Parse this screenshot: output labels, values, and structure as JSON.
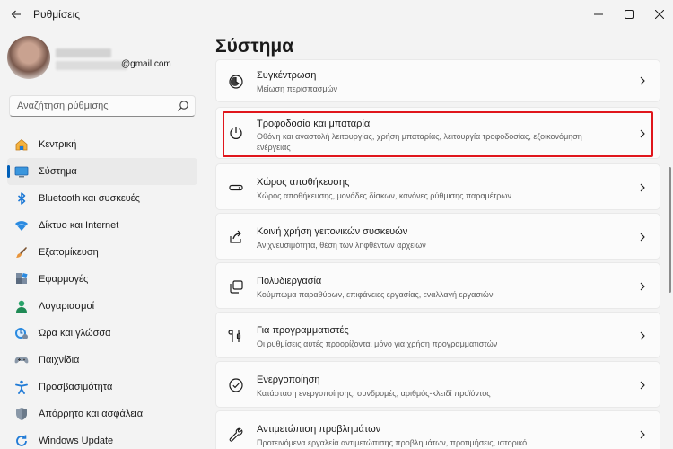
{
  "window": {
    "title": "Ρυθμίσεις"
  },
  "profile": {
    "email_domain": "@gmail.com"
  },
  "search": {
    "placeholder": "Αναζήτηση ρύθμισης"
  },
  "sidebar": {
    "items": [
      {
        "label": "Κεντρική",
        "icon": "home-icon"
      },
      {
        "label": "Σύστημα",
        "icon": "system-icon",
        "active": true
      },
      {
        "label": "Bluetooth και συσκευές",
        "icon": "bluetooth-icon"
      },
      {
        "label": "Δίκτυο και Internet",
        "icon": "wifi-icon"
      },
      {
        "label": "Εξατομίκευση",
        "icon": "brush-icon"
      },
      {
        "label": "Εφαρμογές",
        "icon": "apps-icon"
      },
      {
        "label": "Λογαριασμοί",
        "icon": "account-icon"
      },
      {
        "label": "Ώρα και γλώσσα",
        "icon": "time-language-icon"
      },
      {
        "label": "Παιχνίδια",
        "icon": "gamepad-icon"
      },
      {
        "label": "Προσβασιμότητα",
        "icon": "accessibility-icon"
      },
      {
        "label": "Απόρρητο και ασφάλεια",
        "icon": "shield-icon"
      },
      {
        "label": "Windows Update",
        "icon": "update-icon"
      }
    ]
  },
  "main": {
    "title": "Σύστημα",
    "cards": [
      {
        "title": "Συγκέντρωση",
        "desc": "Μείωση περισπασμών",
        "icon": "focus-icon"
      },
      {
        "title": "Τροφοδοσία και μπαταρία",
        "desc": "Οθόνη και αναστολή λειτουργίας, χρήση μπαταρίας, λειτουργία τροφοδοσίας, εξοικονόμηση ενέργειας",
        "icon": "power-icon"
      },
      {
        "title": "Χώρος αποθήκευσης",
        "desc": "Χώρος αποθήκευσης, μονάδες δίσκων, κανόνες ρύθμισης παραμέτρων",
        "icon": "storage-icon"
      },
      {
        "title": "Κοινή χρήση γειτονικών συσκευών",
        "desc": "Ανιχνευσιμότητα, θέση των ληφθέντων αρχείων",
        "icon": "share-icon"
      },
      {
        "title": "Πολυδιεργασία",
        "desc": "Κούμπωμα παραθύρων, επιφάνειες εργασίας, εναλλαγή εργασιών",
        "icon": "multitasking-icon"
      },
      {
        "title": "Για προγραμματιστές",
        "desc": "Οι ρυθμίσεις αυτές προορίζονται μόνο για χρήση προγραμματιστών",
        "icon": "developer-icon"
      },
      {
        "title": "Ενεργοποίηση",
        "desc": "Κατάσταση ενεργοποίησης, συνδρομές, αριθμός-κλειδί προϊόντος",
        "icon": "activation-icon"
      },
      {
        "title": "Αντιμετώπιση προβλημάτων",
        "desc": "Προτεινόμενα εργαλεία αντιμετώπισης προβλημάτων, προτιμήσεις, ιστορικό",
        "icon": "troubleshoot-icon"
      }
    ]
  },
  "colors": {
    "accent": "#005fb8",
    "highlight": "#e0161c"
  }
}
